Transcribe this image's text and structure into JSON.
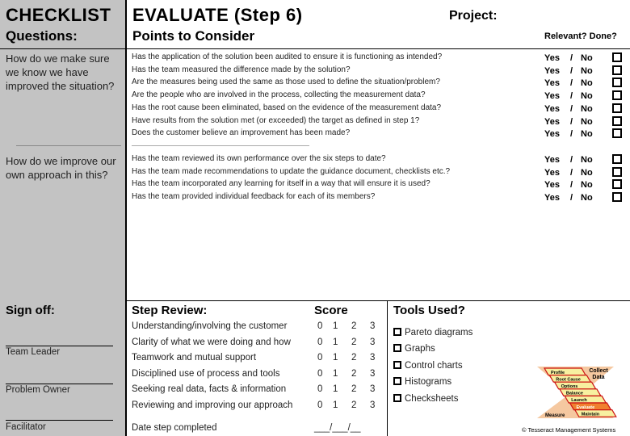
{
  "header": {
    "checklist": "CHECKLIST",
    "title": "EVALUATE  (Step 6)",
    "project_label": "Project:",
    "questions_label": "Questions:",
    "points_label": "Points to Consider",
    "relevant_done": "Relevant? Done?"
  },
  "sections": [
    {
      "question": "How do we make sure we know we have improved the situation?",
      "points": [
        "Has the application of the solution been audited to ensure it is functioning as intended?",
        "Has the team measured the difference made by the solution?",
        "Are the measures being used the same as those used to define the situation/problem?",
        "Are the people who are involved in the process, collecting the measurement data?",
        "Has the root cause been eliminated, based on the evidence of the measurement data?",
        "Have results from the solution met (or exceeded) the target as defined in step 1?",
        "Does the customer believe an improvement has been made?"
      ]
    },
    {
      "question": "How do we improve our own approach in this?",
      "points": [
        "Has the team reviewed its own performance over the six steps to date?",
        "Has the team made recommendations to update the guidance document, checklists etc.?",
        "Has the team incorporated any learning for itself in a way that will ensure it is used?",
        "Has the team provided individual feedback for each of its members?"
      ]
    }
  ],
  "yes_no": {
    "yes": "Yes",
    "sep": "/",
    "no": "No"
  },
  "signoff": {
    "title": "Sign off:",
    "roles": [
      "Team Leader",
      "Problem Owner",
      "Facilitator"
    ]
  },
  "step_review": {
    "title": "Step Review:",
    "score_label": "Score",
    "items": [
      "Understanding/involving the customer",
      "Clarity of what we were doing and how",
      "Teamwork and mutual support",
      "Disciplined use of process and tools",
      "Seeking real data, facts & information",
      "Reviewing and improving our approach"
    ],
    "scores": [
      "0",
      "1",
      "2",
      "3"
    ],
    "date_label": "Date step completed",
    "date_blank": "___/___/__"
  },
  "tools": {
    "title": "Tools Used?",
    "items": [
      "Pareto diagrams",
      "Graphs",
      "Control charts",
      "Histograms",
      "Checksheets"
    ]
  },
  "logo": {
    "steps": [
      "Profile",
      "Root Cause",
      "Options",
      "Balance",
      "Launch",
      "Evaluate",
      "Maintain"
    ],
    "collect": "Collect Data",
    "measure": "Measure",
    "active_step": "Evaluate",
    "colors": {
      "bar": "#f7f0a0",
      "border": "#cc1111",
      "active": "#f08030",
      "bg": "#f5c8a0"
    }
  },
  "copyright": "© Tesseract Management Systems"
}
